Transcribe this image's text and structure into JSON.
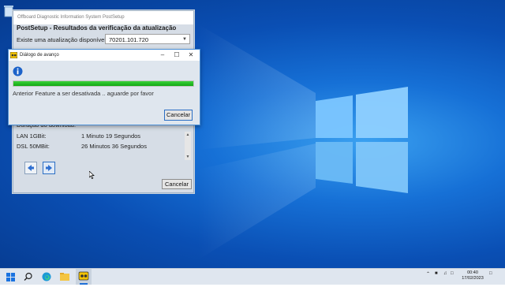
{
  "main_window": {
    "title": "Offboard Diagnostic Information System PostSetup",
    "header": "PostSetup - Resultados da verificação da atualização",
    "available_label": "Existe uma atualização disponível.",
    "available_version": "70201.101.720",
    "download": {
      "title": "Duração do download:",
      "rows": [
        {
          "label": "LAN 1GBit:",
          "value": "1 Minuto 19 Segundos"
        },
        {
          "label": "DSL 50MBit:",
          "value": "26 Minutos 36 Segundos"
        }
      ]
    },
    "cancel_label": "Cancelar"
  },
  "progress_dialog": {
    "title": "Diálogo de avanço",
    "message": "Anterior Feature a ser desativada .. aguarde por favor",
    "progress": 1.0,
    "cancel_label": "Cancelar"
  },
  "taskbar": {
    "time": "00:40",
    "date": "17/02/2023",
    "icons": [
      "windows-start-icon",
      "search-icon",
      "edge-icon",
      "file-explorer-icon",
      "odis-app-icon"
    ],
    "tray_icons": [
      "chevron-up-icon",
      "network-icon",
      "volume-icon",
      "language-icon",
      "notification-icon"
    ]
  },
  "colors": {
    "progress_fill": "#13a813",
    "accent": "#2c6fc4"
  }
}
